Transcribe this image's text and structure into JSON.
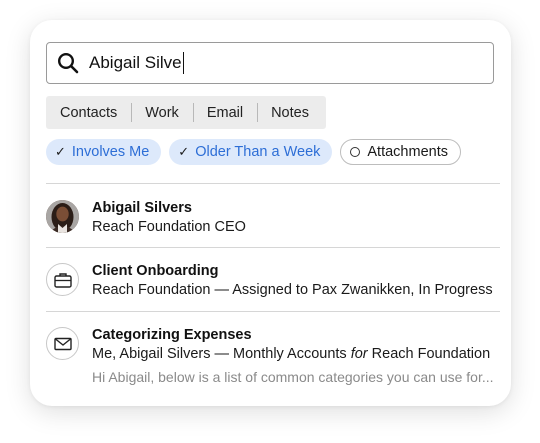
{
  "search": {
    "value": "Abigail Silve"
  },
  "segments": [
    "Contacts",
    "Work",
    "Email",
    "Notes"
  ],
  "filters": [
    {
      "label": "Involves Me",
      "state": "checked"
    },
    {
      "label": "Older Than a Week",
      "state": "checked"
    },
    {
      "label": "Attachments",
      "state": "unchecked"
    }
  ],
  "results": [
    {
      "type": "contact",
      "icon": "avatar",
      "title": "Abigail Silvers",
      "subtitle": "Reach Foundation CEO"
    },
    {
      "type": "work",
      "icon": "briefcase-icon",
      "title": "Client Onboarding",
      "subtitle": "Reach Foundation — Assigned to Pax Zwanikken, In Progress"
    },
    {
      "type": "email",
      "icon": "envelope-icon",
      "title": "Categorizing Expenses",
      "subtitle_pre": "Me, Abigail Silvers — Monthly Accounts ",
      "subtitle_em": "for",
      "subtitle_post": " Reach Foundation",
      "preview": "Hi Abigail, below is a list of common categories you can use for..."
    }
  ],
  "colors": {
    "accent": "#2d6ed6",
    "chip_bg": "#dde9fb",
    "segmented_bg": "#ececec"
  }
}
